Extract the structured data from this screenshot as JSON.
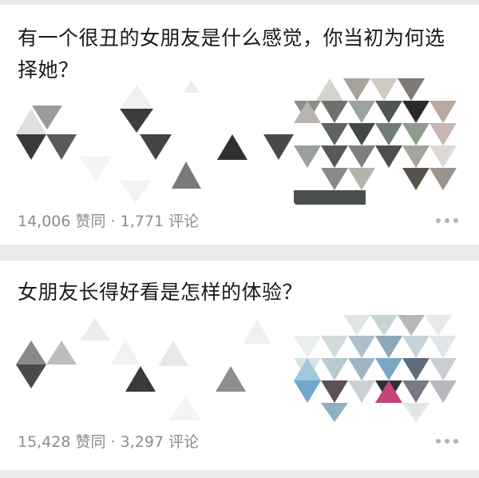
{
  "feed": {
    "items": [
      {
        "title": "有一个很丑的女朋友是什么感觉，你当初为何选择她？",
        "meta": "14,006 赞同 · 1,771 评论"
      },
      {
        "title": "女朋友长得好看是怎样的体验？",
        "meta": "15,428 赞同 · 3,297 评论"
      }
    ]
  }
}
